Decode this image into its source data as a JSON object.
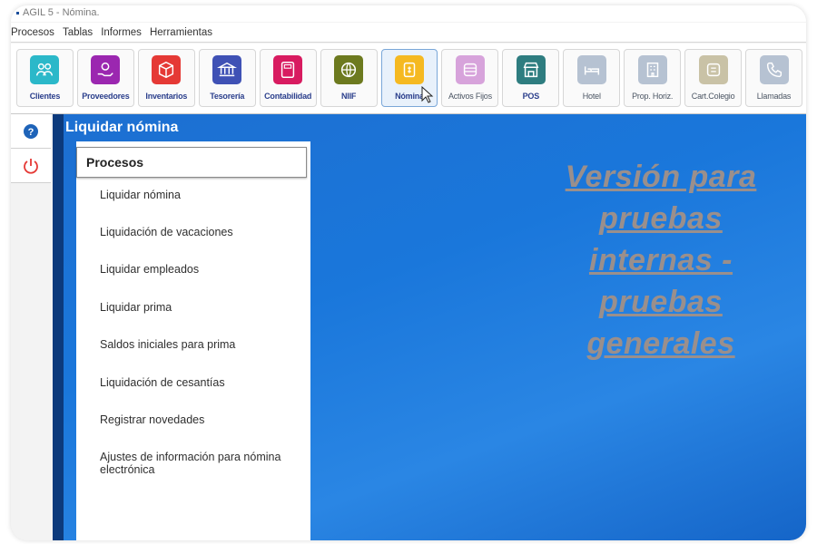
{
  "window": {
    "title": "AGIL 5 - Nómina."
  },
  "menu": [
    "Procesos",
    "Tablas",
    "Informes",
    "Herramientas"
  ],
  "toolbar": [
    {
      "label": "Clientes",
      "icon": "users-icon",
      "color": "#2bb8c9"
    },
    {
      "label": "Proveedores",
      "icon": "hand-coin-icon",
      "color": "#9b27b0"
    },
    {
      "label": "Inventarios",
      "icon": "box-icon",
      "color": "#e53935"
    },
    {
      "label": "Tesorería",
      "icon": "bank-icon",
      "color": "#3f51b5"
    },
    {
      "label": "Contabilidad",
      "icon": "calculator-icon",
      "color": "#d81b60"
    },
    {
      "label": "NIIF",
      "icon": "globe-icon",
      "color": "#6d7a1f"
    },
    {
      "label": "Nómina",
      "icon": "payroll-icon",
      "color": "#f5b921"
    },
    {
      "label": "Activos Fijos",
      "icon": "assets-icon",
      "color": "#d7a3db"
    },
    {
      "label": "POS",
      "icon": "store-icon",
      "color": "#2e7d80"
    },
    {
      "label": "Hotel",
      "icon": "bed-icon",
      "color": "#b6c2d2"
    },
    {
      "label": "Prop. Horiz.",
      "icon": "building-icon",
      "color": "#b6c2d2"
    },
    {
      "label": "Cart.Colegio",
      "icon": "school-icon",
      "color": "#c9c2a6"
    },
    {
      "label": "Llamadas",
      "icon": "phone-icon",
      "color": "#b6c2d2"
    }
  ],
  "active_tool": "Nómina",
  "panel": {
    "title": "Liquidar nómina",
    "header": "Procesos",
    "items": [
      "Liquidar nómina",
      "Liquidación de vacaciones",
      "Liquidar empleados",
      "Liquidar prima",
      "Saldos iniciales para prima",
      "Liquidación de cesantías",
      "Registrar novedades",
      "Ajustes de información para nómina electrónica"
    ]
  },
  "watermark": [
    "Versión para",
    "pruebas",
    "internas -",
    "pruebas",
    "generales"
  ],
  "side_buttons": [
    {
      "icon": "help-icon"
    },
    {
      "icon": "power-icon"
    }
  ]
}
